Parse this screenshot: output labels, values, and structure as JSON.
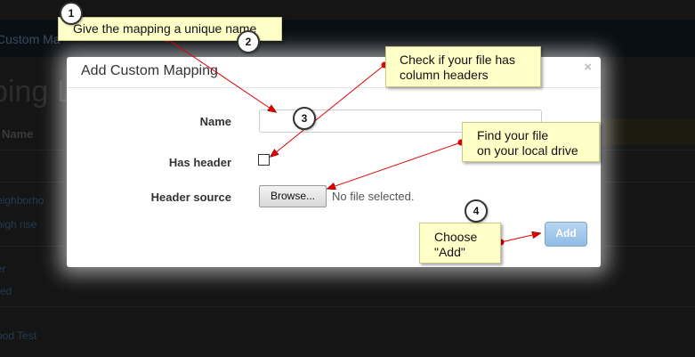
{
  "background_page": {
    "topbar_text": "Custom Ma",
    "heading": "ping L",
    "column_header": "Name",
    "rows": [
      "eighborho",
      "high rise",
      "er",
      "red",
      "ood Test"
    ]
  },
  "modal": {
    "title": "Add Custom Mapping",
    "close_glyph": "×",
    "fields": {
      "name_label": "Name",
      "name_value": "",
      "has_header_label": "Has header",
      "has_header_checked": false,
      "header_source_label": "Header source",
      "browse_label": "Browse...",
      "file_status": "No file selected."
    },
    "add_label": "Add"
  },
  "callouts": [
    {
      "text": "Give the mapping a unique name"
    },
    {
      "text_lines": [
        "Check if your file has",
        "column headers"
      ]
    },
    {
      "text_lines": [
        "Find your file",
        "on your local drive"
      ]
    },
    {
      "text_lines": [
        "Choose",
        "\"Add\""
      ]
    }
  ],
  "badges": [
    "1",
    "2",
    "3",
    "4"
  ],
  "colors": {
    "callout_bg": "#ffffc8",
    "arrow": "#e00000",
    "add_button": "#8fbbe4"
  }
}
